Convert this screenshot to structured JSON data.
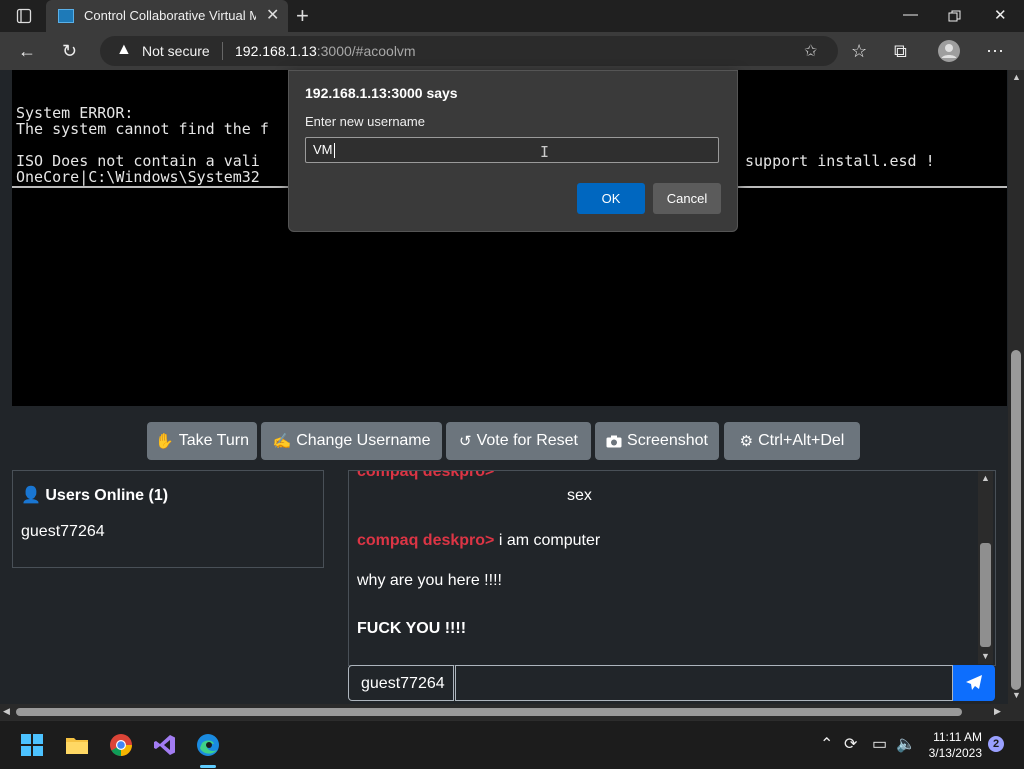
{
  "browser": {
    "tab_title": "Control Collaborative Virtual Ma",
    "address": {
      "security": "Not secure",
      "host": "192.168.1.13",
      "rest": ":3000/#acoolvm"
    }
  },
  "console": {
    "lines": [
      "System ERROR:",
      "The system cannot find the f",
      "ISO Does not contain a vali",
      "OneCore|C:\\Windows\\System32",
      "support install.esd !"
    ]
  },
  "toolbar": {
    "take_turn": "Take Turn",
    "change_username": "Change Username",
    "vote_reset": "Vote for Reset",
    "screenshot": "Screenshot",
    "ctrl_alt_del": "Ctrl+Alt+Del"
  },
  "users_panel": {
    "title": "Users Online (1)",
    "users": [
      "guest77264"
    ]
  },
  "chat": {
    "messages": [
      {
        "user": "compaq deskpro>",
        "text": ""
      },
      {
        "user": "",
        "text": "sex"
      },
      {
        "user": "compaq deskpro>",
        "text": "i am computer"
      },
      {
        "user": "",
        "text": "why are you here !!!!"
      },
      {
        "user": "",
        "text": "FUCK YOU !!!!"
      }
    ],
    "username": "guest77264",
    "input_value": ""
  },
  "dialog": {
    "title": "192.168.1.13:3000 says",
    "label": "Enter new username",
    "value": "VM",
    "ok": "OK",
    "cancel": "Cancel"
  },
  "taskbar": {
    "time": "11:11 AM",
    "date": "3/13/2023",
    "notifications": "2"
  },
  "colors": {
    "accent": "#0067c0",
    "send": "#0d6efd",
    "chat_user": "#dc3545",
    "button": "#6c757d"
  }
}
